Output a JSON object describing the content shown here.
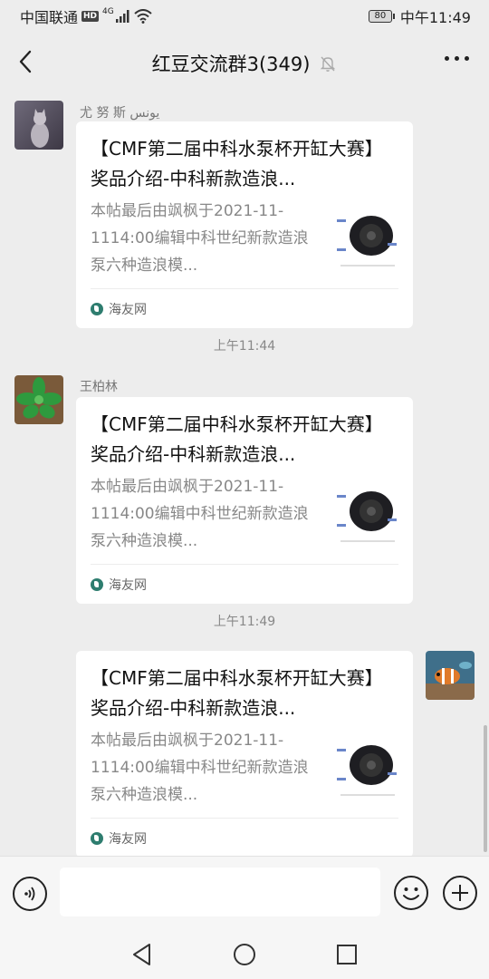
{
  "status_bar": {
    "carrier": "中国联通",
    "hd_badge": "HD",
    "network": "4G",
    "battery_level": "80",
    "time": "中午11:49"
  },
  "header": {
    "title": "红豆交流群3(349)",
    "back_icon": "chevron-left-icon",
    "mute_icon": "bell-off-icon",
    "more_icon": "more-dots-icon"
  },
  "messages": [
    {
      "sender": "尤 努 斯  يونس",
      "card": {
        "title": "【CMF第二届中科水泵杯开缸大赛】奖品介绍-中科新款造浪...",
        "desc": "本帖最后由飒枫于2021-11-1114:00编辑中科世纪新款造浪泵六种造浪模...",
        "source": "海友网"
      }
    },
    {
      "time": "上午11:44",
      "sender": "王柏林",
      "card": {
        "title": "【CMF第二届中科水泵杯开缸大赛】奖品介绍-中科新款造浪...",
        "desc": "本帖最后由飒枫于2021-11-1114:00编辑中科世纪新款造浪泵六种造浪模...",
        "source": "海友网"
      }
    },
    {
      "time": "上午11:49",
      "card": {
        "title": "【CMF第二届中科水泵杯开缸大赛】奖品介绍-中科新款造浪...",
        "desc": "本帖最后由飒枫于2021-11-1114:00编辑中科世纪新款造浪泵六种造浪模...",
        "source": "海友网"
      }
    }
  ],
  "input_bar": {
    "value": "",
    "voice_icon": "voice-icon",
    "emoji_icon": "emoji-icon",
    "plus_icon": "plus-icon"
  },
  "nav": {
    "back_icon": "triangle-back-icon",
    "home_icon": "circle-home-icon",
    "recents_icon": "square-recents-icon"
  }
}
